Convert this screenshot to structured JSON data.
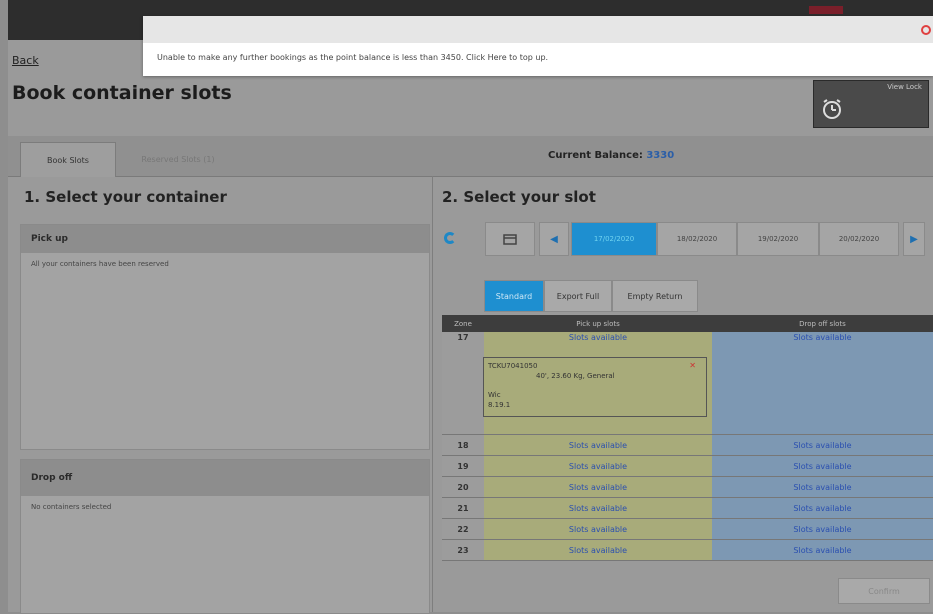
{
  "header": {
    "back_label": "Back",
    "title": "Book container slots",
    "view_lock_label": "View Lock"
  },
  "notification": {
    "message": "Unable to make any further bookings as the point balance is less than 3450. Click Here to top up."
  },
  "tabs": [
    {
      "label": "Book Slots"
    },
    {
      "label": "Reserved Slots (1)"
    }
  ],
  "balance": {
    "label": "Current Balance:",
    "value": "3330"
  },
  "left": {
    "heading": "1. Select your container",
    "pickup": {
      "title": "Pick up",
      "text": "All your containers have been reserved"
    },
    "dropoff": {
      "title": "Drop off",
      "text": "No containers selected"
    }
  },
  "right": {
    "heading": "2. Select your slot",
    "dates": [
      "17/02/2020",
      "18/02/2020",
      "19/02/2020",
      "20/02/2020"
    ],
    "selected_date_index": 0,
    "filters": [
      "Standard",
      "Export Full",
      "Empty Return"
    ],
    "table_headers": {
      "zone": "Zone",
      "pickup": "Pick up slots",
      "dropoff": "Drop off slots"
    },
    "rows": [
      {
        "zone": "17",
        "pickup": "Slots available",
        "dropoff": "Slots available"
      },
      {
        "zone": "18",
        "pickup": "Slots available",
        "dropoff": "Slots available"
      },
      {
        "zone": "19",
        "pickup": "Slots available",
        "dropoff": "Slots available"
      },
      {
        "zone": "20",
        "pickup": "Slots available",
        "dropoff": "Slots available"
      },
      {
        "zone": "21",
        "pickup": "Slots available",
        "dropoff": "Slots available"
      },
      {
        "zone": "22",
        "pickup": "Slots available",
        "dropoff": "Slots available"
      },
      {
        "zone": "23",
        "pickup": "Slots available",
        "dropoff": "Slots available"
      }
    ],
    "booked_card": {
      "id": "TCKU7041050",
      "description": "40', 23.60 Kg, General",
      "line1": "Wic",
      "line2": "8.19.1"
    },
    "confirm_label": "Confirm"
  },
  "colors": {
    "accent": "#1e8fd0",
    "pickup": "#a8ab7a",
    "dropoff": "#7d98b3"
  }
}
